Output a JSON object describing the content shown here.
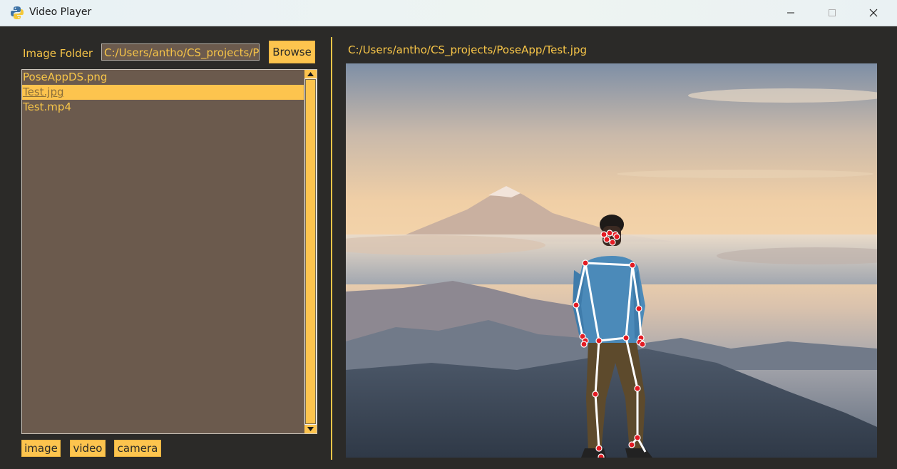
{
  "window": {
    "title": "Video Player",
    "controls": [
      "minimize",
      "maximize",
      "close"
    ]
  },
  "left_panel": {
    "folder_label": "Image Folder",
    "folder_value": "C:/Users/antho/CS_projects/P",
    "browse_label": "Browse",
    "files": [
      {
        "name": "PoseAppDS.png",
        "selected": false
      },
      {
        "name": "Test.jpg",
        "selected": true
      },
      {
        "name": "Test.mp4",
        "selected": false
      }
    ],
    "mode_buttons": {
      "image": "image",
      "video": "video",
      "camera": "camera"
    }
  },
  "right_panel": {
    "image_path": "C:/Users/antho/CS_projects/PoseApp/Test.jpg",
    "image_description": "person standing on mountain with pose skeleton overlay"
  },
  "colors": {
    "accent": "#fdc44e",
    "text_accent": "#f7c548",
    "background": "#2b2a28",
    "listbox": "#6b5a4d",
    "skeleton_line": "#ffffff",
    "keypoint": "#e31b23"
  }
}
